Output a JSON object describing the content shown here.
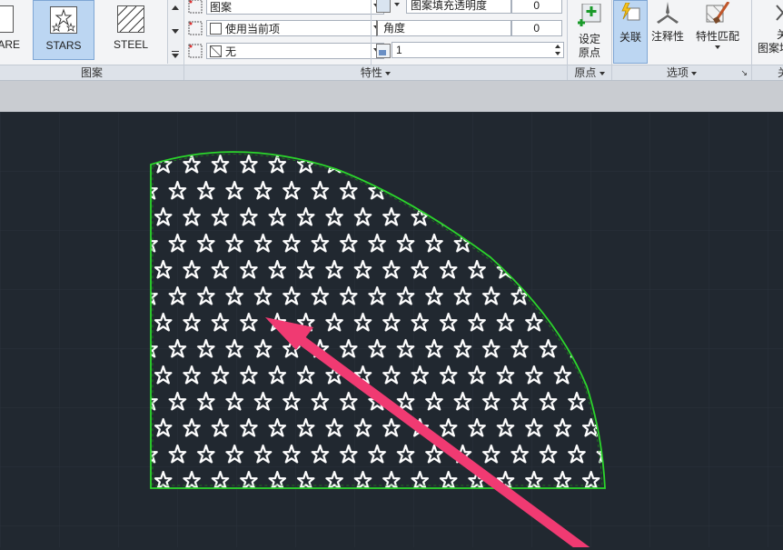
{
  "pattern_panel": {
    "swatches": [
      {
        "label": "ARE",
        "selected": false
      },
      {
        "label": "STARS",
        "selected": true
      },
      {
        "label": "STEEL",
        "selected": false
      }
    ],
    "title": "图案"
  },
  "properties_panel": {
    "pattern_type_value": "图案",
    "color_value": "使用当前项",
    "background_value": "无",
    "transparency_label": "图案填充透明度",
    "transparency_value": "0",
    "angle_label": "角度",
    "angle_value": "0",
    "scale_value": "1",
    "title": "特性"
  },
  "origin_panel": {
    "set_origin_line1": "设定",
    "set_origin_line2": "原点",
    "title": "原点"
  },
  "options_panel": {
    "associative_label": "关联",
    "annotative_label": "注释性",
    "match_properties_label": "特性匹配",
    "title": "选项"
  },
  "close_panel": {
    "label_line1": "关",
    "label_line2": "图案填",
    "title": "关"
  },
  "colors": {
    "canvas": "#212830",
    "boundary": "#2bd62b",
    "hatch": "#ffffff",
    "arrow": "#f03a72",
    "selected_tool": "#bcd6f2"
  }
}
